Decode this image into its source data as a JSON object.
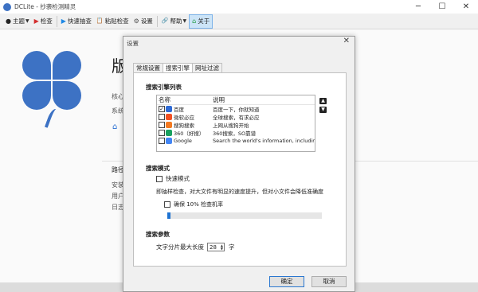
{
  "window": {
    "title": "DCLite - 抄袭检测精灵",
    "controls": [
      "─",
      "☐",
      "✕"
    ]
  },
  "toolbar": {
    "items": [
      {
        "name": "theme-menu",
        "label": "主题",
        "icon": "●",
        "dropdown": true
      },
      {
        "name": "check-button",
        "label": "检查",
        "icon": "▶",
        "dropdown": false
      },
      {
        "name": "quick-scan-button",
        "label": "快速抽查",
        "icon": "▶",
        "dropdown": false
      },
      {
        "name": "paste-check-button",
        "label": "粘贴检查",
        "icon": "📋",
        "dropdown": false
      },
      {
        "name": "settings-button",
        "label": "设置",
        "icon": "⚙",
        "dropdown": false
      },
      {
        "name": "help-menu",
        "label": "帮助",
        "icon": "🔗",
        "dropdown": true
      },
      {
        "name": "about-button",
        "label": "关于",
        "icon": "⌂",
        "dropdown": false
      }
    ]
  },
  "background": {
    "heading": "版",
    "lines": [
      "核心",
      "系统"
    ],
    "section": "路径",
    "items": [
      "安装",
      "用户",
      "日志"
    ]
  },
  "dialog": {
    "title": "设置",
    "close": "✕",
    "tabs": [
      "常规设置",
      "搜索引擎",
      "网址过滤"
    ],
    "active_tab": 1,
    "engines_title": "搜索引擎列表",
    "col_name": "名称",
    "col_desc": "说明",
    "engines": [
      {
        "checked": true,
        "name": "百度",
        "desc": "百度一下，你就知道",
        "icon_color": "#2f6bd6"
      },
      {
        "checked": false,
        "name": "微软必应",
        "desc": "全球搜索，有求必应",
        "icon_color": "#f25022"
      },
      {
        "checked": false,
        "name": "搜狗搜索",
        "desc": "上网从搜狗开始",
        "icon_color": "#f47a20"
      },
      {
        "checked": false,
        "name": "360（好搜）",
        "desc": "360搜索，SO靠谱",
        "icon_color": "#19a15f"
      },
      {
        "checked": false,
        "name": "Google",
        "desc": "Search the world's information, including ...",
        "icon_color": "#4285f4"
      }
    ],
    "up_arrow": "▲",
    "down_arrow": "▼",
    "mode_title": "搜索模式",
    "quick_mode": {
      "checked": false,
      "label": "快速模式"
    },
    "mode_desc": "即抽样检查，对大文件有明显的速度提升，但对小文件会降低准确度",
    "sample_rate": {
      "checked": false,
      "label": "确保 10% 检查机率",
      "fraction": 0.02
    },
    "params_title": "搜索参数",
    "segment_label": "文字分片最大长度",
    "segment_value": "28",
    "segment_unit": "字",
    "ok": "确定",
    "cancel": "取消"
  }
}
